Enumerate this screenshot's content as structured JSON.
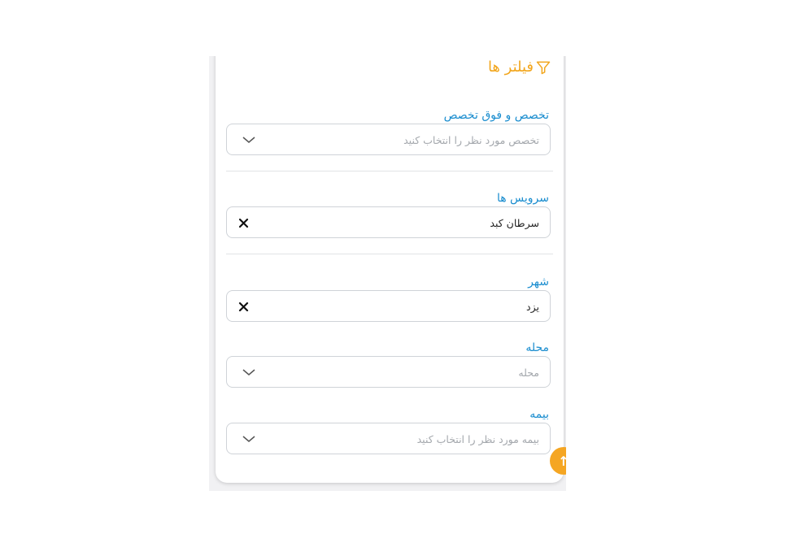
{
  "filters": {
    "title": "فیلتر ها",
    "specialty": {
      "label": "تخصص و فوق تخصص",
      "placeholder": "تخصص مورد نظر را انتخاب کنید"
    },
    "services": {
      "label": "سرویس ها",
      "value": "سرطان کبد"
    },
    "city": {
      "label": "شهر",
      "value": "یزد"
    },
    "neighborhood": {
      "label": "محله",
      "placeholder": "محله"
    },
    "insurance": {
      "label": "بیمه",
      "placeholder": "بیمه مورد نظر را انتخاب کنید"
    }
  },
  "scroll_top": {
    "icon": "arrow-up-icon",
    "glyph": "↑"
  },
  "colors": {
    "accent_orange": "#f2a61d",
    "label_blue": "#1a8dcf"
  }
}
